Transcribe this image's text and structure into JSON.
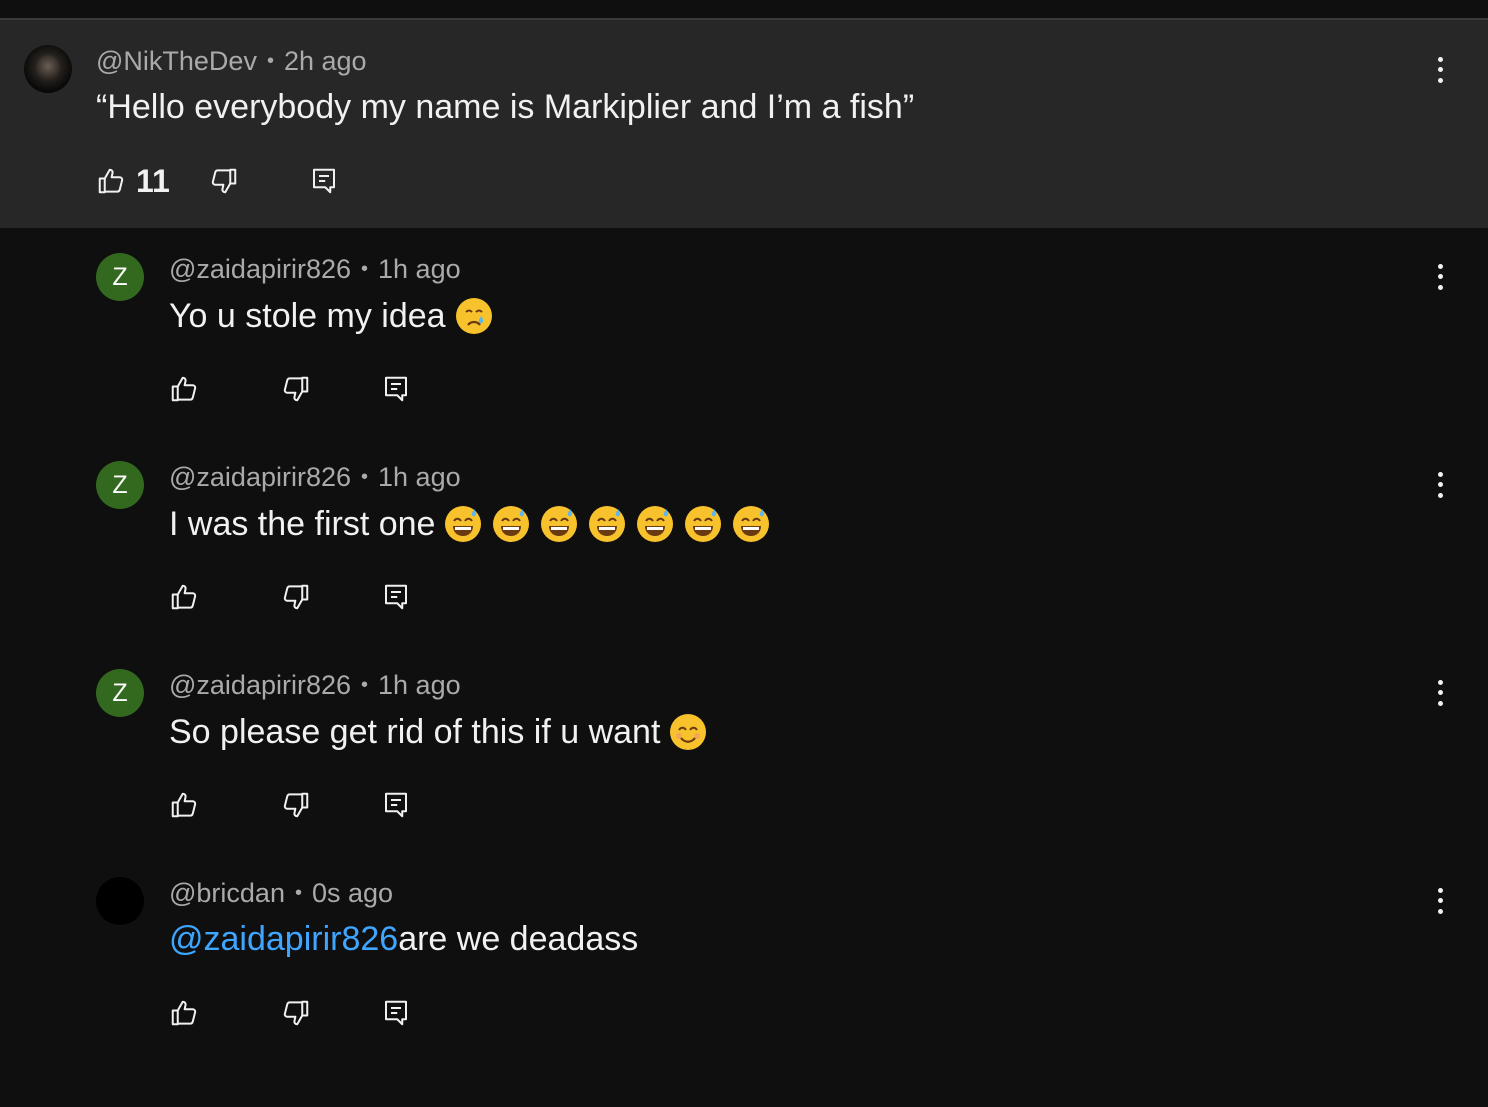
{
  "parent_comment": {
    "author": "@NikTheDev",
    "time": "2h ago",
    "text": "“Hello everybody my name is Markiplier and I’m a fish”",
    "likes": "11",
    "avatar": "profile-photo"
  },
  "replies": [
    {
      "author": "@zaidapirir826",
      "time": "1h ago",
      "avatar_letter": "Z",
      "text": "Yo u stole my idea",
      "emojis": [
        "crying-face"
      ]
    },
    {
      "author": "@zaidapirir826",
      "time": "1h ago",
      "avatar_letter": "Z",
      "text": "I was the first one",
      "emojis": [
        "sweat-smile",
        "sweat-smile",
        "sweat-smile",
        "sweat-smile",
        "sweat-smile",
        "sweat-smile",
        "sweat-smile"
      ]
    },
    {
      "author": "@zaidapirir826",
      "time": "1h ago",
      "avatar_letter": "Z",
      "text": "So please get rid of this if u want",
      "emojis": [
        "smiling-face"
      ]
    },
    {
      "author": "@bricdan",
      "time": "0s ago",
      "mention": "@zaidapirir826",
      "text": "are we deadass"
    }
  ],
  "separator": "•",
  "colors": {
    "background": "#0f0f0f",
    "parent_background": "#272727",
    "avatar_green": "#33691e",
    "mention_blue": "#3ea6ff",
    "meta_gray": "#aaaaaa",
    "text": "#f1f1f1"
  },
  "icons": {
    "like": "thumbs-up-icon",
    "dislike": "thumbs-down-icon",
    "reply": "reply-icon",
    "more": "more-vert-icon"
  }
}
